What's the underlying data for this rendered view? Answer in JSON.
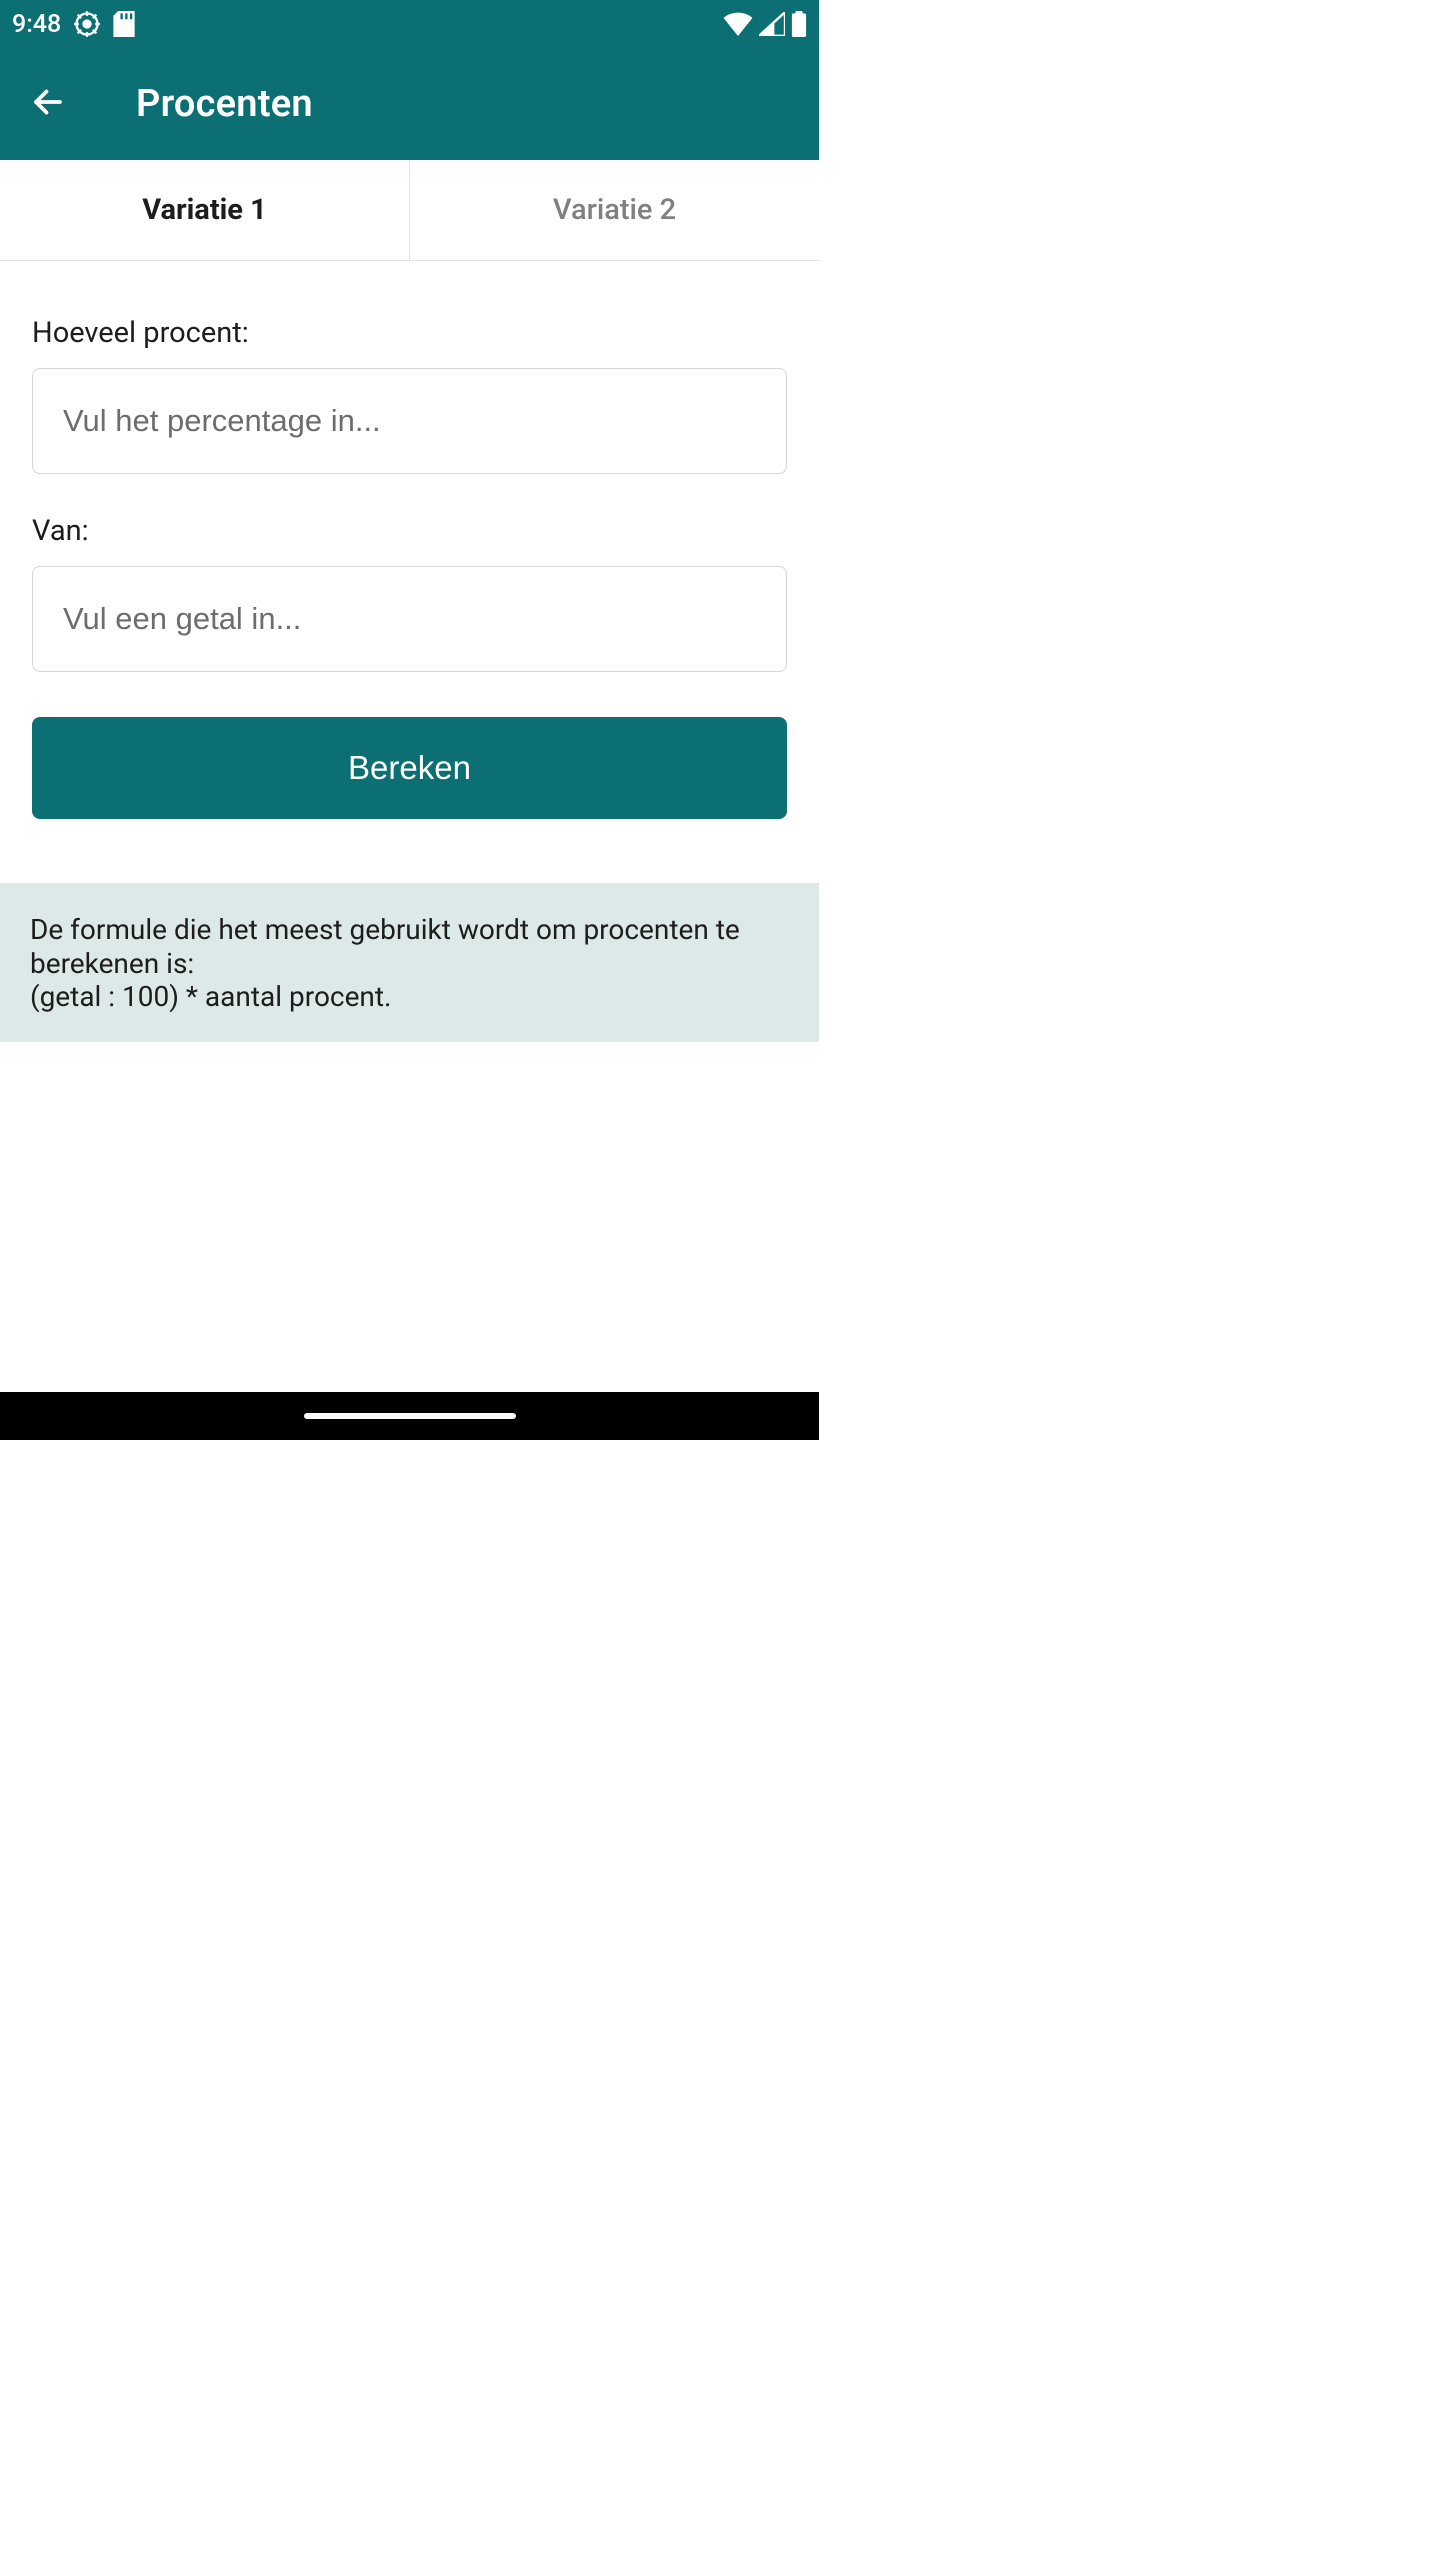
{
  "status": {
    "time": "9:48"
  },
  "appbar": {
    "title": "Procenten"
  },
  "tabs": [
    {
      "label": "Variatie 1"
    },
    {
      "label": "Variatie 2"
    }
  ],
  "form": {
    "percentage_label": "Hoeveel procent:",
    "percentage_placeholder": "Vul het percentage in...",
    "of_label": "Van:",
    "of_placeholder": "Vul een getal in...",
    "calculate_label": "Bereken"
  },
  "info": {
    "text": "De formule die het meest gebruikt wordt om procenten te berekenen is:\n(getal : 100) * aantal procent."
  }
}
